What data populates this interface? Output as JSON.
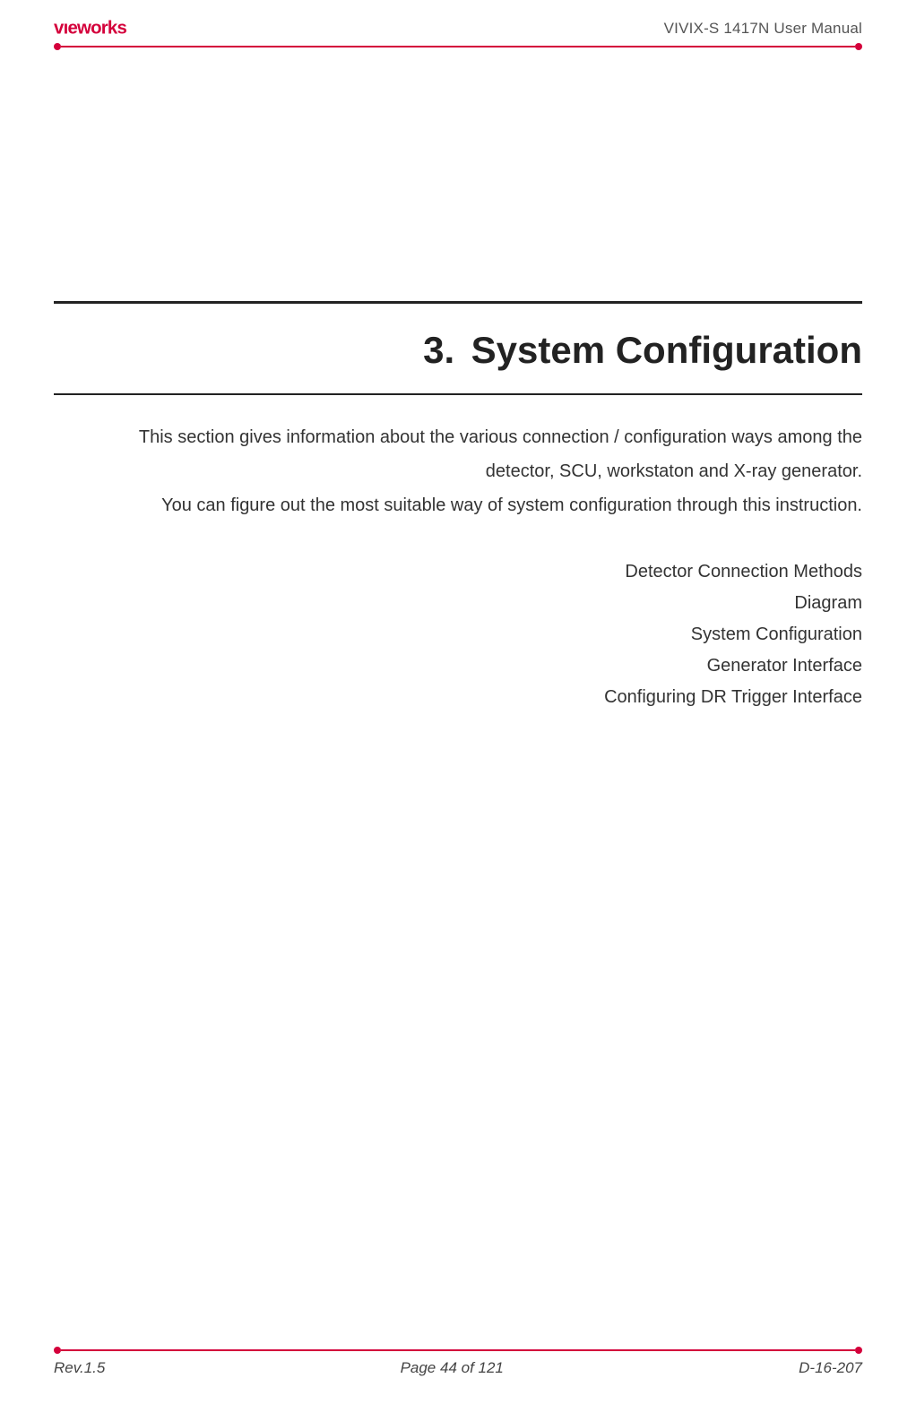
{
  "header": {
    "logo_text": "vieworks",
    "doc_title": "VIVIX-S 1417N User Manual"
  },
  "section": {
    "number": "3.",
    "title": "System Configuration",
    "intro_line_1": "This section gives information about the various connection / configuration ways among the",
    "intro_line_2": "detector, SCU, workstaton and X-ray generator.",
    "intro_line_3": "You can figure out the most suitable way of system configuration through this instruction.",
    "toc": [
      "Detector Connection Methods",
      "Diagram",
      "System Configuration",
      "Generator Interface",
      "Configuring DR Trigger Interface"
    ]
  },
  "footer": {
    "rev": "Rev.1.5",
    "page": "Page 44 of 121",
    "doc_id": "D-16-207"
  },
  "colors": {
    "accent": "#d4003b"
  }
}
